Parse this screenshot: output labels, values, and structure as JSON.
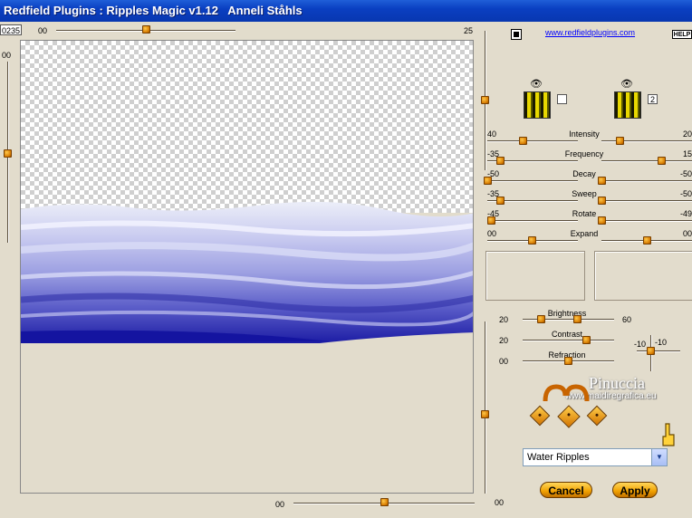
{
  "window": {
    "title": "Redfield Plugins : Ripples Magic v1.12   Anneli Ståhls"
  },
  "top": {
    "seed": "0235",
    "top_slider_min": "00",
    "top_slider_max": "25",
    "link": "www.redfieldplugins.com",
    "help": "HELP",
    "top_slider_position": 0.5
  },
  "left_slider": {
    "label": "00"
  },
  "bottom_slider": {
    "label": "00"
  },
  "right_vertical_slider": {
    "label": "00"
  },
  "params": [
    {
      "label": "Intensity",
      "left": "40",
      "right": "20"
    },
    {
      "label": "Frequency",
      "left": "-35",
      "right": "15"
    },
    {
      "label": "Decay",
      "left": "-50",
      "right": "-50"
    },
    {
      "label": "Sweep",
      "left": "-35",
      "right": "-50"
    },
    {
      "label": "Rotate",
      "left": "-45",
      "right": "-49"
    },
    {
      "label": "Expand",
      "left": "00",
      "right": "00"
    }
  ],
  "lighting": [
    {
      "label": "Brightness",
      "left": "20",
      "right": "60"
    },
    {
      "label": "Contrast",
      "left": "20",
      "right": ""
    },
    {
      "label": "Refraction",
      "left": "00",
      "right": ""
    }
  ],
  "xy": {
    "x": "-10",
    "y": "-10"
  },
  "texture_badge": "2",
  "watermark": {
    "name": "Pinuccia",
    "url": "www.maidiregrafica.eu"
  },
  "preset": {
    "selected": "Water Ripples"
  },
  "buttons": {
    "cancel": "Cancel",
    "apply": "Apply"
  },
  "colors": {
    "title_bar": "#0a3fc1",
    "background": "#e2dccc",
    "button": "#f0a000",
    "water": "#3c3cc0"
  }
}
